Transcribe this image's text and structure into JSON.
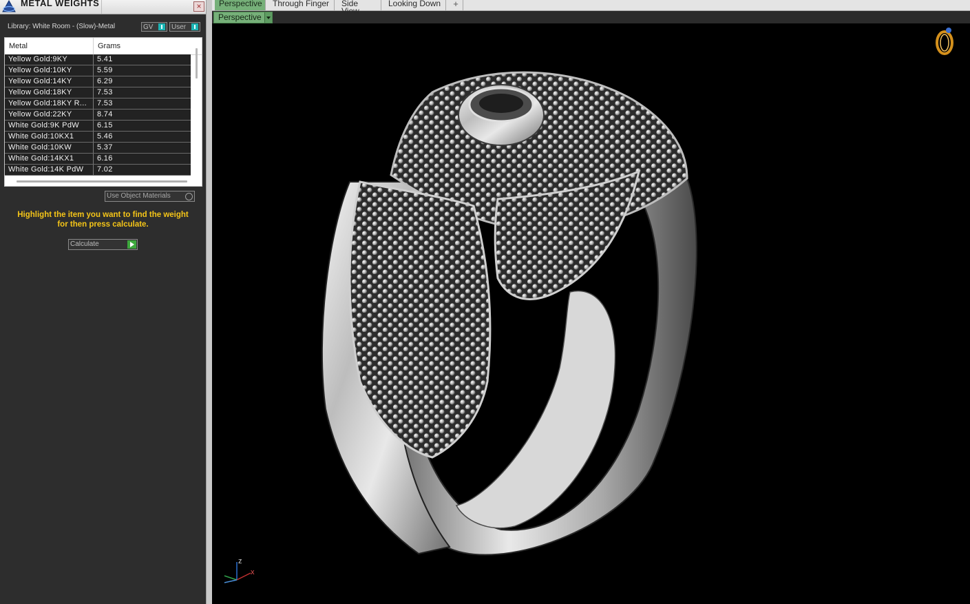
{
  "panel": {
    "title": "METAL WEIGHTS",
    "close": "×",
    "library": "Library: White Room - (Slow)-Metal",
    "toggles": [
      {
        "label": "GV"
      },
      {
        "label": "User"
      }
    ],
    "columns": [
      "Metal",
      "Grams"
    ],
    "rows": [
      {
        "metal": "Yellow Gold:9KY",
        "grams": "5.41"
      },
      {
        "metal": "Yellow Gold:10KY",
        "grams": "5.59"
      },
      {
        "metal": "Yellow Gold:14KY",
        "grams": "6.29"
      },
      {
        "metal": "Yellow Gold:18KY",
        "grams": "7.53"
      },
      {
        "metal": "Yellow Gold:18KY R...",
        "grams": "7.53"
      },
      {
        "metal": "Yellow Gold:22KY",
        "grams": "8.74"
      },
      {
        "metal": "White Gold:9K PdW",
        "grams": "6.15"
      },
      {
        "metal": "White Gold:10KX1",
        "grams": "5.46"
      },
      {
        "metal": "White Gold:10KW",
        "grams": "5.37"
      },
      {
        "metal": "White Gold:14KX1",
        "grams": "6.16"
      },
      {
        "metal": "White Gold:14K PdW",
        "grams": "7.02"
      }
    ],
    "use_object_materials": "Use Object Materials",
    "hint_line1": "Highlight the item you want to find the weight",
    "hint_line2": "for then press calculate.",
    "calculate": "Calculate"
  },
  "tabs": [
    "Perspective",
    "Through Finger",
    "Side View",
    "Looking Down"
  ],
  "tab_add": "+",
  "active_tab": 0,
  "view_dropdown": "Perspective",
  "axes": {
    "z": "z",
    "x": "x"
  },
  "colors": {
    "accent_green": "#76b079",
    "hint_yellow": "#f5c518",
    "toggle_cyan": "#1bb4b4",
    "viewport_bg": "#000000"
  },
  "icons": [
    "app-logo-icon",
    "close-icon",
    "toggle-indicator-icon",
    "radio-icon",
    "play-arrow-icon",
    "plus-icon",
    "dropdown-arrow-icon",
    "ring-icon",
    "axis-gizmo-icon"
  ]
}
